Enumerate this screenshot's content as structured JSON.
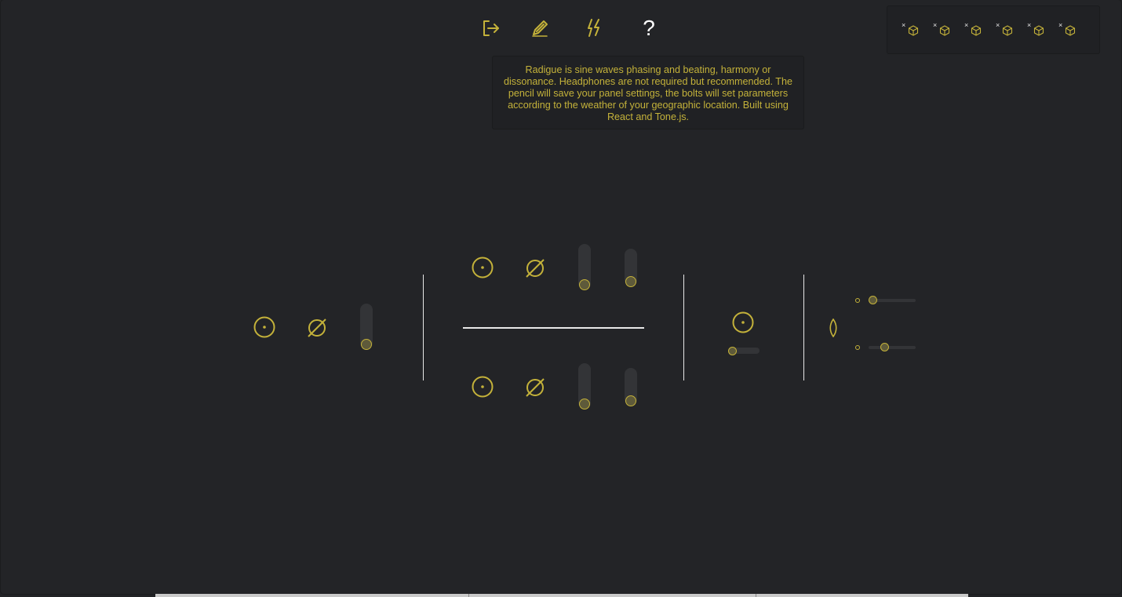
{
  "toolbar": {
    "icons": [
      "logout-icon",
      "pencil-icon",
      "bolt-icon"
    ],
    "help_label": "?"
  },
  "info": {
    "text": "Radigue is sine waves phasing and beating, harmony or dissonance. Headphones are not required but recommended. The pencil will save your panel settings, the bolts will set parameters according to the weather of your geographic location. Built using React and Tone.js."
  },
  "presets": {
    "count": 6,
    "remove_label": "×",
    "icon": "cube-icon"
  },
  "colors": {
    "accent": "#c4b23a",
    "background": "#232427",
    "divider": "#e8e8e8",
    "track": "#333437"
  },
  "controls": {
    "left_slider_level": 0.0,
    "top_slider_1_level": 0.0,
    "top_slider_2_level": 0.0,
    "bottom_slider_1_level": 0.0,
    "bottom_slider_2_level": 0.0,
    "center_h_slider_level": 0.0,
    "right_slider_1_level": 0.1,
    "right_slider_2_level": 0.3
  }
}
